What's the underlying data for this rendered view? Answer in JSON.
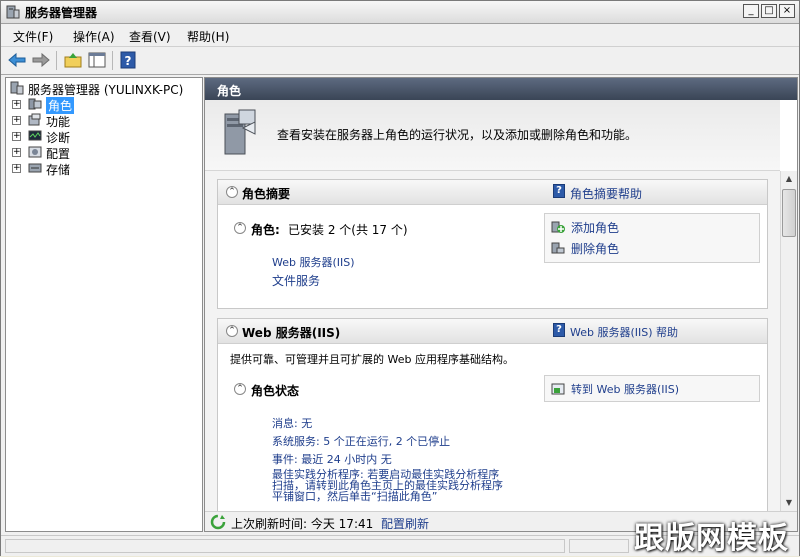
{
  "window": {
    "title": "服务器管理器",
    "controls": {
      "minimize": "_",
      "maximize": "□",
      "close": "×"
    }
  },
  "menu": [
    "文件(F)",
    "操作(A)",
    "查看(V)",
    "帮助(H)"
  ],
  "toolbar": {
    "back": "back-arrow",
    "forward": "forward-arrow",
    "up": "folder-up",
    "view": "show-hide-tree",
    "help": "?"
  },
  "tree": {
    "root": "服务器管理器 (YULINXK-PC)",
    "items": [
      {
        "label": "角色",
        "expand": "+",
        "selected": true
      },
      {
        "label": "功能",
        "expand": "+"
      },
      {
        "label": "诊断",
        "expand": "+"
      },
      {
        "label": "配置",
        "expand": "+"
      },
      {
        "label": "存储",
        "expand": "+"
      }
    ]
  },
  "panel": {
    "header": "角色",
    "intro": "查看安装在服务器上角色的运行状况，以及添加或删除角色和功能。",
    "roles_summary": {
      "title": "角色摘要",
      "help": "角色摘要帮助",
      "roles_label": "角色:",
      "roles_value": "已安装 2 个(共 17 个)",
      "installed": [
        "Web 服务器(IIS)",
        "文件服务"
      ],
      "actions": [
        "添加角色",
        "删除角色"
      ]
    },
    "web_server": {
      "title": "Web 服务器(IIS)",
      "help": "Web 服务器(IIS) 帮助",
      "description": "提供可靠、可管理并且可扩展的 Web 应用程序基础结构。",
      "status_title": "角色状态",
      "goto": "转到 Web 服务器(IIS)",
      "status": [
        "消息: 无",
        "系统服务: 5 个正在运行, 2 个已停止",
        "事件: 最近 24 小时内 无"
      ],
      "bpa_lines": [
        "最佳实践分析程序: 若要启动最佳实践分析程序",
        "扫描，请转到此角色主页上的最佳实践分析程序",
        "平铺窗口，然后单击“扫描此角色”"
      ]
    },
    "status_bar": {
      "text": "上次刷新时间: 今天 17:41",
      "refresh": "配置刷新"
    }
  },
  "watermark": "跟版网模板",
  "colors": {
    "header_bg": "#4a5568",
    "link": "#1f3e8c",
    "selection": "#3399ff"
  }
}
